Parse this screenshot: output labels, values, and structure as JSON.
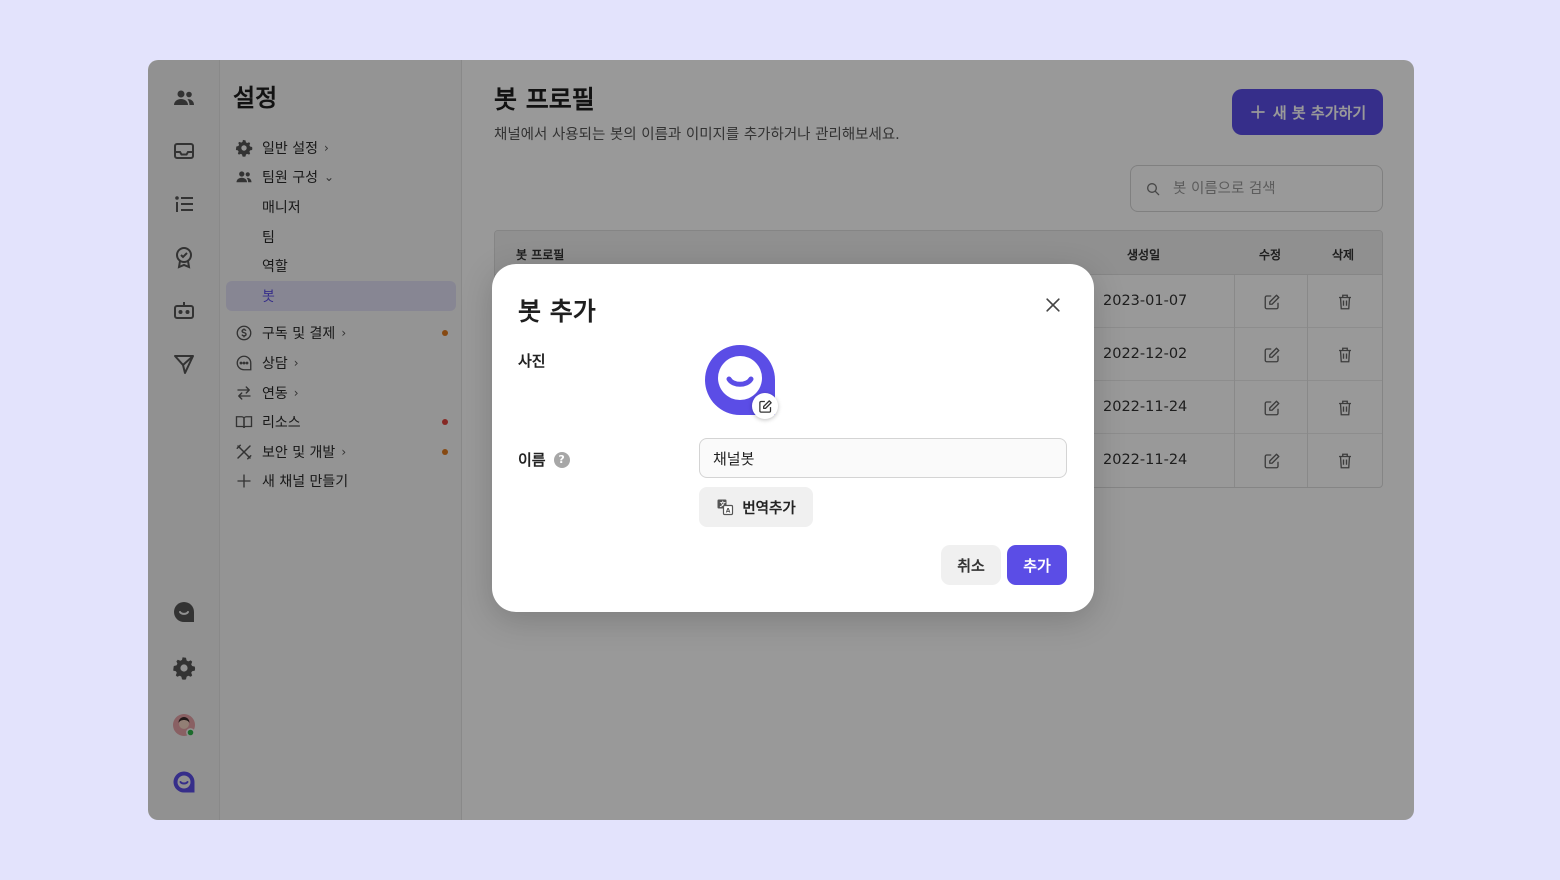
{
  "sidebar": {
    "title": "설정",
    "items": [
      {
        "label": "일반 설정",
        "icon": "gear-icon"
      },
      {
        "label": "팀원 구성",
        "icon": "users-icon"
      },
      {
        "label": "매니저"
      },
      {
        "label": "팀"
      },
      {
        "label": "역할"
      },
      {
        "label": "봇"
      },
      {
        "label": "구독 및 결제",
        "icon": "dollar-icon",
        "dot_color": "#e07a1f"
      },
      {
        "label": "상담",
        "icon": "chat-bubble-icon"
      },
      {
        "label": "연동",
        "icon": "swap-arrows-icon"
      },
      {
        "label": "리소스",
        "icon": "book-icon",
        "dot_color": "#e0443c"
      },
      {
        "label": "보안 및 개발",
        "icon": "tools-icon",
        "dot_color": "#e07a1f"
      },
      {
        "label": "새 채널 만들기",
        "icon": "plus-icon"
      }
    ]
  },
  "main": {
    "title": "봇 프로필",
    "description": "채널에서 사용되는 봇의 이름과 이미지를 추가하거나 관리해보세요.",
    "add_button": "새 봇 추가하기",
    "search_placeholder": "봇 이름으로 검색",
    "table": {
      "headers": [
        "봇 프로필",
        "생성일",
        "수정",
        "삭제"
      ],
      "rows": [
        {
          "created": "2023-01-07"
        },
        {
          "created": "2022-12-02"
        },
        {
          "created": "2022-11-24"
        },
        {
          "created": "2022-11-24"
        }
      ]
    }
  },
  "modal": {
    "title": "봇 추가",
    "photo_label": "사진",
    "name_label": "이름",
    "name_value": "채널봇",
    "translate_button": "번역추가",
    "cancel": "취소",
    "confirm": "추가"
  },
  "colors": {
    "accent": "#5b4de6",
    "page_background": "#e3e3fc",
    "online_status": "#2fb34a"
  }
}
